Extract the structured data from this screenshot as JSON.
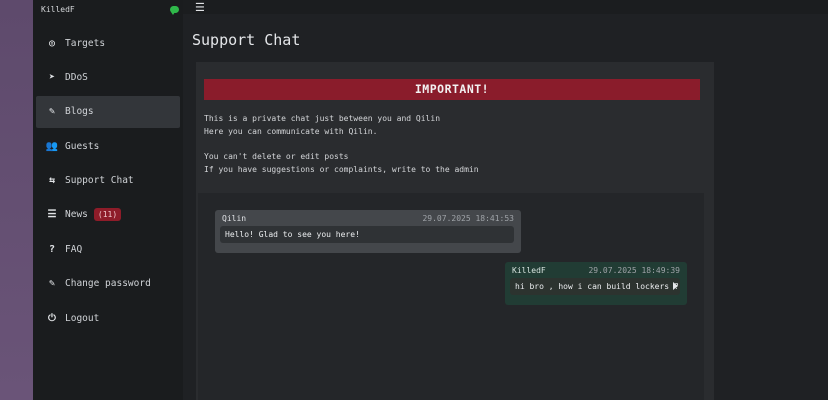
{
  "sidebar": {
    "username": "KilledF",
    "items": [
      {
        "label": "Targets",
        "icon": "◎"
      },
      {
        "label": "DDoS",
        "icon": "➤"
      },
      {
        "label": "Blogs",
        "icon": "✎"
      },
      {
        "label": "Guests",
        "icon": "👥"
      },
      {
        "label": "Support Chat",
        "icon": "⇆"
      },
      {
        "label": "News",
        "icon": "☰",
        "badge": "(11)"
      },
      {
        "label": "FAQ",
        "icon": "?"
      },
      {
        "label": "Change password",
        "icon": "✎"
      },
      {
        "label": "Logout",
        "icon": "⏻"
      }
    ]
  },
  "header": {
    "menu_icon": "☰"
  },
  "page": {
    "title": "Support Chat"
  },
  "important": {
    "banner": "IMPORTANT!",
    "lines": [
      "This is a private chat just between you and Qilin",
      "Here you can communicate with Qilin.",
      "You can't delete or edit posts",
      "If you have suggestions or complaints, write to the admin"
    ]
  },
  "messages": [
    {
      "author": "Qilin",
      "time": "29.07.2025 18:41:53",
      "text": "Hello! Glad to see you here!"
    },
    {
      "author": "KilledF",
      "time": "29.07.2025 18:49:39",
      "text": "hi bro , how i can build lockers ?"
    }
  ],
  "colors": {
    "accent_red": "#8a1c2b",
    "badge_red": "#8e1c29",
    "online_green": "#2fb84a",
    "outgoing_msg": "#213c34"
  }
}
